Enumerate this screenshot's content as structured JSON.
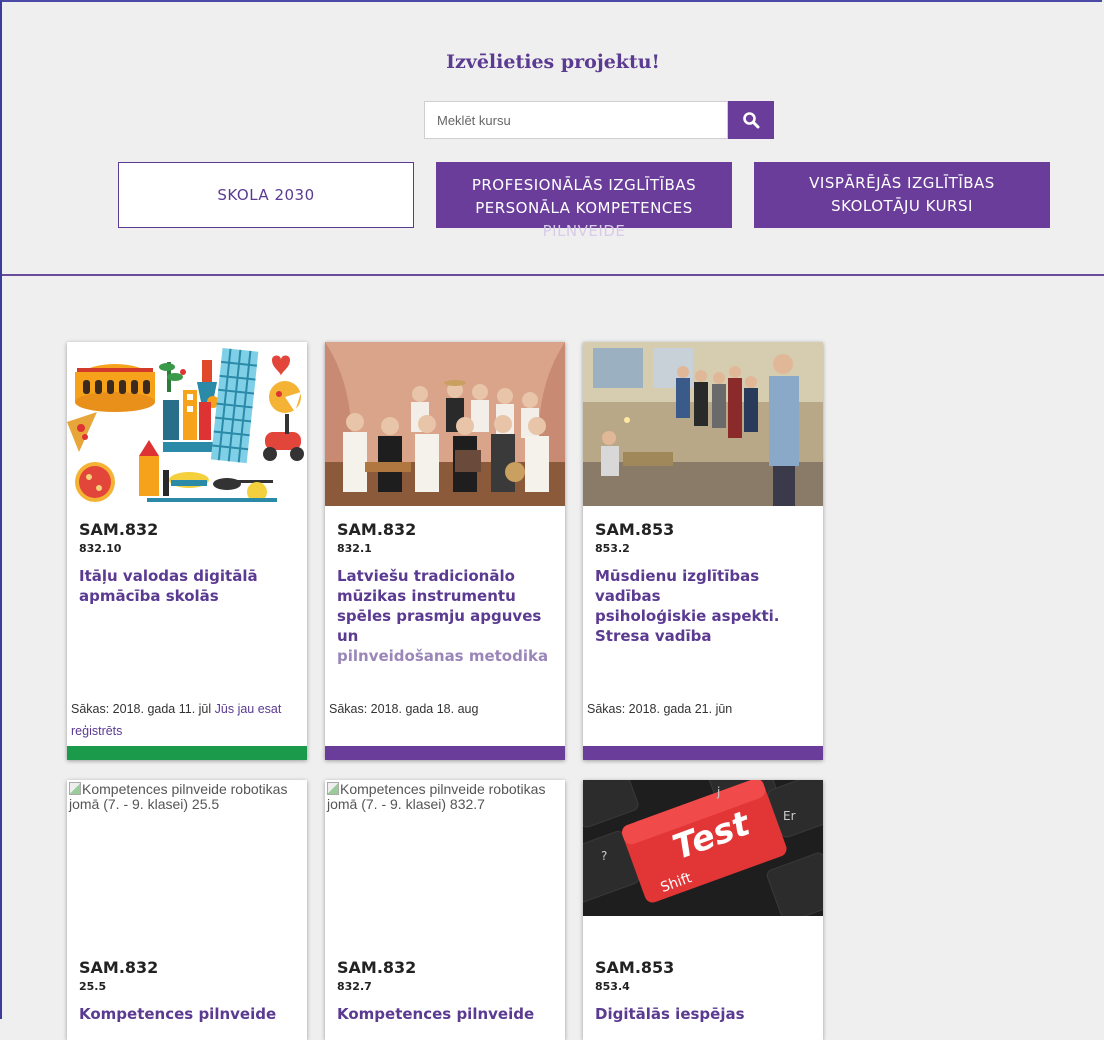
{
  "header": {
    "title": "Izvēlieties projektu!",
    "search_placeholder": "Meklēt kursu",
    "search_icon": "search-icon",
    "projects": [
      {
        "line1": "SKOLA 2030",
        "line2": "",
        "line3": ""
      },
      {
        "line1": "PROFESIONĀLĀS IZGLĪTĪBAS",
        "line2": "PERSONĀLA KOMPETENCES",
        "line3": "PILNVEIDE"
      },
      {
        "line1": "VISPĀRĒJĀS IZGLĪTĪBAS",
        "line2": "SKOLOTĀJU KURSI",
        "line3": ""
      }
    ]
  },
  "colors": {
    "accent": "#6a3d9a",
    "registered_bar": "#1a9a4a",
    "background": "#efefef"
  },
  "courses": [
    {
      "code": "SAM.832",
      "sub": "832.10",
      "name": [
        "Itāļu valodas digitālā",
        "apmācība skolās"
      ],
      "starts": "Sākas: 2018. gada 11. jūl",
      "registered": "Jūs jau esat reģistrēts",
      "image": "italy-illustration"
    },
    {
      "code": "SAM.832",
      "sub": "832.1",
      "name": [
        "Latviešu tradicionālo",
        "mūzikas instrumentu",
        "spēles prasmju apguves un",
        "pilnveidošanas metodika"
      ],
      "starts": "Sākas: 2018. gada 18. aug",
      "registered": "",
      "image": "folk-musicians-photo"
    },
    {
      "code": "SAM.853",
      "sub": "853.2",
      "name": [
        "Mūsdienu izglītības vadības",
        "psiholoģiskie aspekti.",
        "Stresa vadība"
      ],
      "starts": "Sākas: 2018. gada 21. jūn",
      "registered": "",
      "image": "workshop-group-photo"
    },
    {
      "code": "SAM.832",
      "sub": "25.5",
      "name": [
        "Kompetences pilnveide"
      ],
      "broken_alt": "Kompetences pilnveide robotikas jomā (7. - 9. klasei) 25.5",
      "image": "broken-image"
    },
    {
      "code": "SAM.832",
      "sub": "832.7",
      "name": [
        "Kompetences pilnveide"
      ],
      "broken_alt": "Kompetences pilnveide robotikas jomā (7. - 9. klasei) 832.7",
      "image": "broken-image"
    },
    {
      "code": "SAM.853",
      "sub": "853.4",
      "name": [
        "Digitālās iespējas"
      ],
      "test_key": "Test",
      "shift_key": "Shift",
      "image": "test-keyboard-photo"
    }
  ]
}
